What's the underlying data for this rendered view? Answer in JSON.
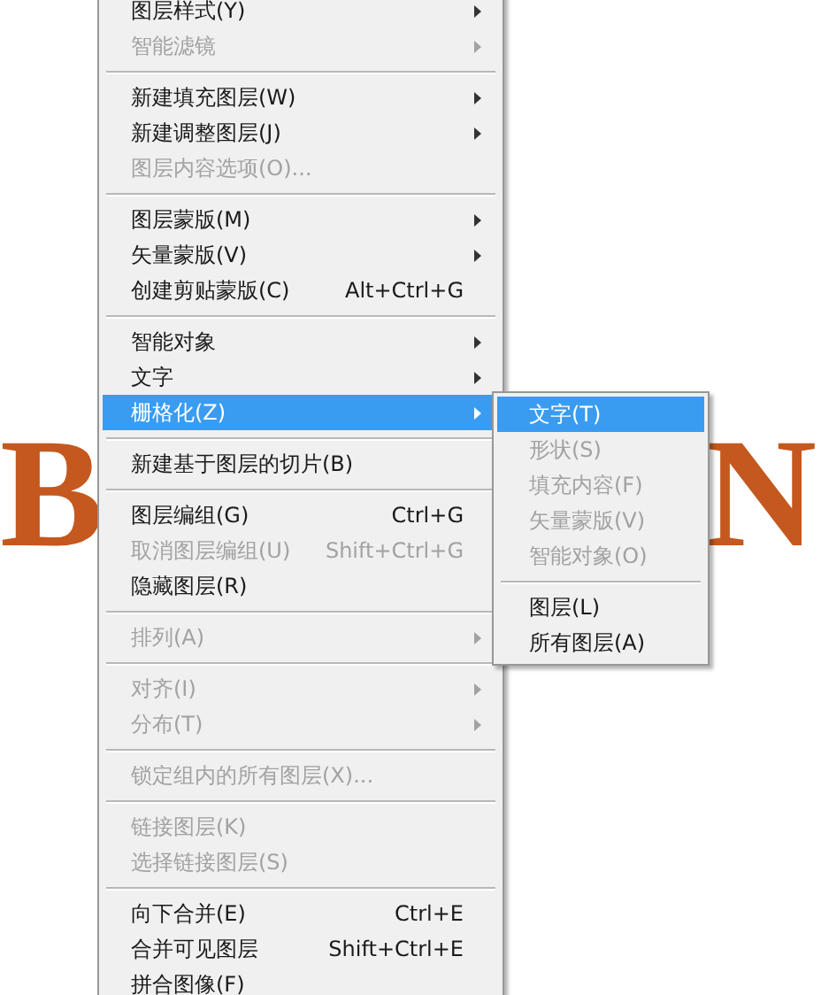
{
  "canvas_text": [
    {
      "text": "B"
    },
    {
      "text": "N"
    }
  ],
  "menu": {
    "items": [
      {
        "kind": "item",
        "label": "图层样式(Y)",
        "arrow": true,
        "disabled": false,
        "selected": false
      },
      {
        "kind": "item",
        "label": "智能滤镜",
        "arrow": true,
        "disabled": true,
        "selected": false
      },
      {
        "kind": "separator"
      },
      {
        "kind": "item",
        "label": "新建填充图层(W)",
        "arrow": true,
        "disabled": false,
        "selected": false
      },
      {
        "kind": "item",
        "label": "新建调整图层(J)",
        "arrow": true,
        "disabled": false,
        "selected": false
      },
      {
        "kind": "item",
        "label": "图层内容选项(O)...",
        "arrow": false,
        "disabled": true,
        "selected": false
      },
      {
        "kind": "separator"
      },
      {
        "kind": "item",
        "label": "图层蒙版(M)",
        "arrow": true,
        "disabled": false,
        "selected": false
      },
      {
        "kind": "item",
        "label": "矢量蒙版(V)",
        "arrow": true,
        "disabled": false,
        "selected": false
      },
      {
        "kind": "item",
        "label": "创建剪贴蒙版(C)",
        "shortcut": "Alt+Ctrl+G",
        "arrow": false,
        "disabled": false,
        "selected": false
      },
      {
        "kind": "separator"
      },
      {
        "kind": "item",
        "label": "智能对象",
        "arrow": true,
        "disabled": false,
        "selected": false
      },
      {
        "kind": "item",
        "label": "文字",
        "arrow": true,
        "disabled": false,
        "selected": false
      },
      {
        "kind": "item",
        "label": "栅格化(Z)",
        "arrow": true,
        "disabled": false,
        "selected": true
      },
      {
        "kind": "separator"
      },
      {
        "kind": "item",
        "label": "新建基于图层的切片(B)",
        "arrow": false,
        "disabled": false,
        "selected": false
      },
      {
        "kind": "separator"
      },
      {
        "kind": "item",
        "label": "图层编组(G)",
        "shortcut": "Ctrl+G",
        "arrow": false,
        "disabled": false,
        "selected": false
      },
      {
        "kind": "item",
        "label": "取消图层编组(U)",
        "shortcut": "Shift+Ctrl+G",
        "arrow": false,
        "disabled": true,
        "selected": false
      },
      {
        "kind": "item",
        "label": "隐藏图层(R)",
        "arrow": false,
        "disabled": false,
        "selected": false
      },
      {
        "kind": "separator"
      },
      {
        "kind": "item",
        "label": "排列(A)",
        "arrow": true,
        "disabled": true,
        "selected": false
      },
      {
        "kind": "separator"
      },
      {
        "kind": "item",
        "label": "对齐(I)",
        "arrow": true,
        "disabled": true,
        "selected": false
      },
      {
        "kind": "item",
        "label": "分布(T)",
        "arrow": true,
        "disabled": true,
        "selected": false
      },
      {
        "kind": "separator"
      },
      {
        "kind": "item",
        "label": "锁定组内的所有图层(X)...",
        "arrow": false,
        "disabled": true,
        "selected": false
      },
      {
        "kind": "separator"
      },
      {
        "kind": "item",
        "label": "链接图层(K)",
        "arrow": false,
        "disabled": true,
        "selected": false
      },
      {
        "kind": "item",
        "label": "选择链接图层(S)",
        "arrow": false,
        "disabled": true,
        "selected": false
      },
      {
        "kind": "separator"
      },
      {
        "kind": "item",
        "label": "向下合并(E)",
        "shortcut": "Ctrl+E",
        "arrow": false,
        "disabled": false,
        "selected": false
      },
      {
        "kind": "item",
        "label": "合并可见图层",
        "shortcut": "Shift+Ctrl+E",
        "arrow": false,
        "disabled": false,
        "selected": false
      },
      {
        "kind": "item",
        "label": "拼合图像(F)",
        "arrow": false,
        "disabled": false,
        "selected": false
      }
    ]
  },
  "submenu": {
    "items": [
      {
        "kind": "item",
        "label": "文字(T)",
        "arrow": false,
        "disabled": false,
        "selected": true
      },
      {
        "kind": "item",
        "label": "形状(S)",
        "arrow": false,
        "disabled": true,
        "selected": false
      },
      {
        "kind": "item",
        "label": "填充内容(F)",
        "arrow": false,
        "disabled": true,
        "selected": false
      },
      {
        "kind": "item",
        "label": "矢量蒙版(V)",
        "arrow": false,
        "disabled": true,
        "selected": false
      },
      {
        "kind": "item",
        "label": "智能对象(O)",
        "arrow": false,
        "disabled": true,
        "selected": false
      },
      {
        "kind": "separator"
      },
      {
        "kind": "item",
        "label": "图层(L)",
        "arrow": false,
        "disabled": false,
        "selected": false
      },
      {
        "kind": "item",
        "label": "所有图层(A)",
        "arrow": false,
        "disabled": false,
        "selected": false
      }
    ]
  }
}
